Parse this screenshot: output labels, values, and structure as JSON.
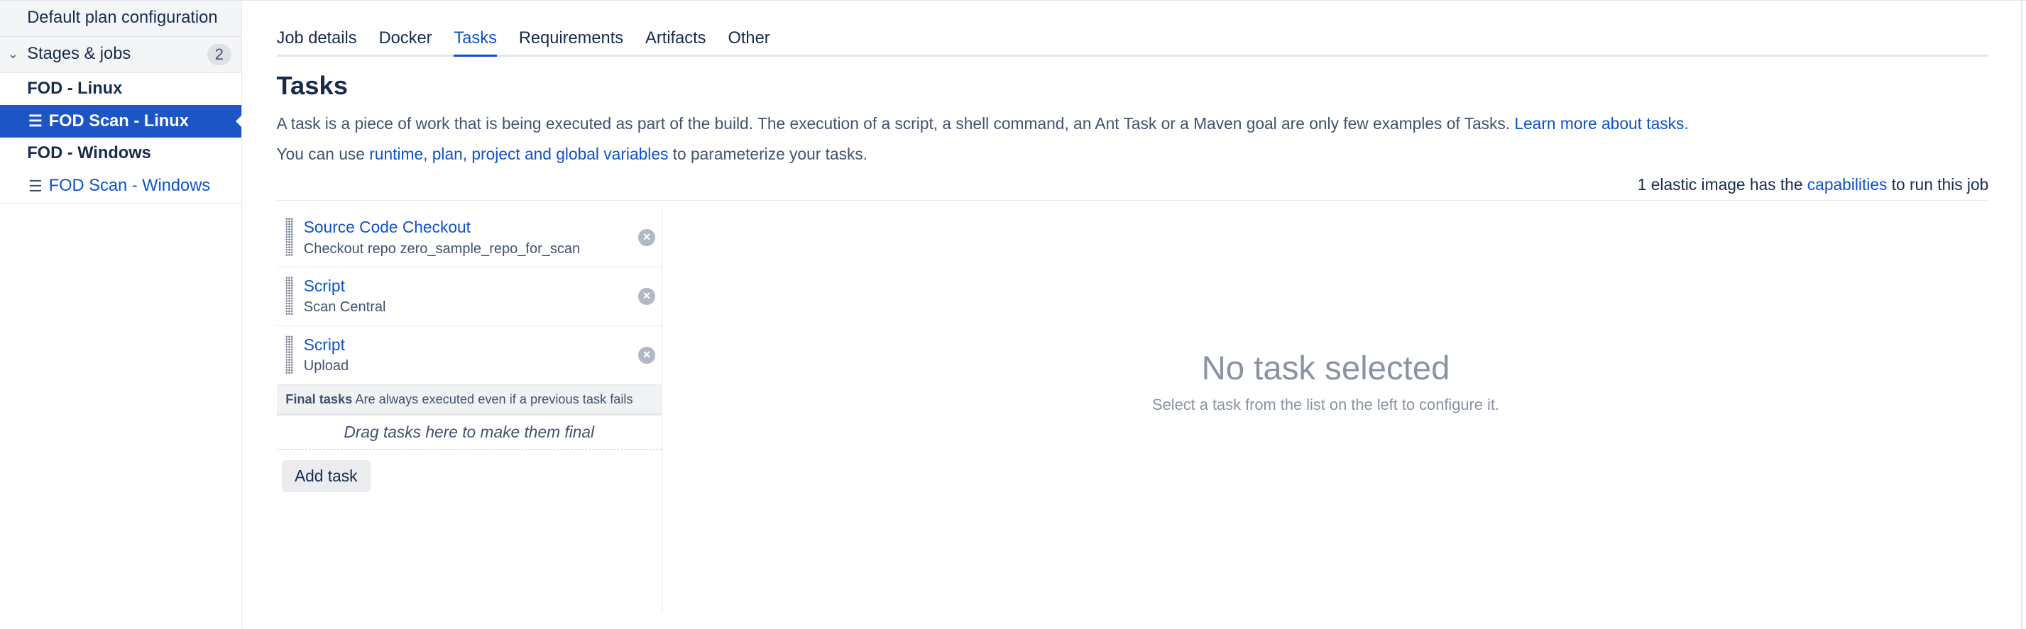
{
  "sidebar": {
    "default_plan": "Default plan configuration",
    "stages_label": "Stages & jobs",
    "stages_count": "2",
    "stages": [
      {
        "name": "FOD - Linux",
        "jobs": [
          {
            "name": "FOD Scan - Linux",
            "active": true
          }
        ]
      },
      {
        "name": "FOD - Windows",
        "jobs": [
          {
            "name": "FOD Scan - Windows",
            "active": false
          }
        ]
      }
    ]
  },
  "tabs": [
    "Job details",
    "Docker",
    "Tasks",
    "Requirements",
    "Artifacts",
    "Other"
  ],
  "active_tab": "Tasks",
  "page_title": "Tasks",
  "description": {
    "text": "A task is a piece of work that is being executed as part of the build. The execution of a script, a shell command, an Ant Task or a Maven goal are only few examples of Tasks. ",
    "link": "Learn more about tasks."
  },
  "variables": {
    "prefix": "You can use ",
    "link": "runtime, plan, project and global variables",
    "suffix": " to parameterize your tasks."
  },
  "capabilities": {
    "prefix": "1 elastic image has the ",
    "link": "capabilities",
    "suffix": " to run this job"
  },
  "tasks": [
    {
      "title": "Source Code Checkout",
      "subtitle": "Checkout repo zero_sample_repo_for_scan"
    },
    {
      "title": "Script",
      "subtitle": "Scan Central"
    },
    {
      "title": "Script",
      "subtitle": "Upload"
    }
  ],
  "final_tasks": {
    "label": "Final tasks",
    "note": "Are always executed even if a previous task fails",
    "drop_hint": "Drag tasks here to make them final"
  },
  "add_task_label": "Add task",
  "empty_state": {
    "title": "No task selected",
    "text": "Select a task from the list on the left to configure it."
  },
  "colors": {
    "accent": "#0c52cc",
    "active_bg": "#1c55c6"
  }
}
